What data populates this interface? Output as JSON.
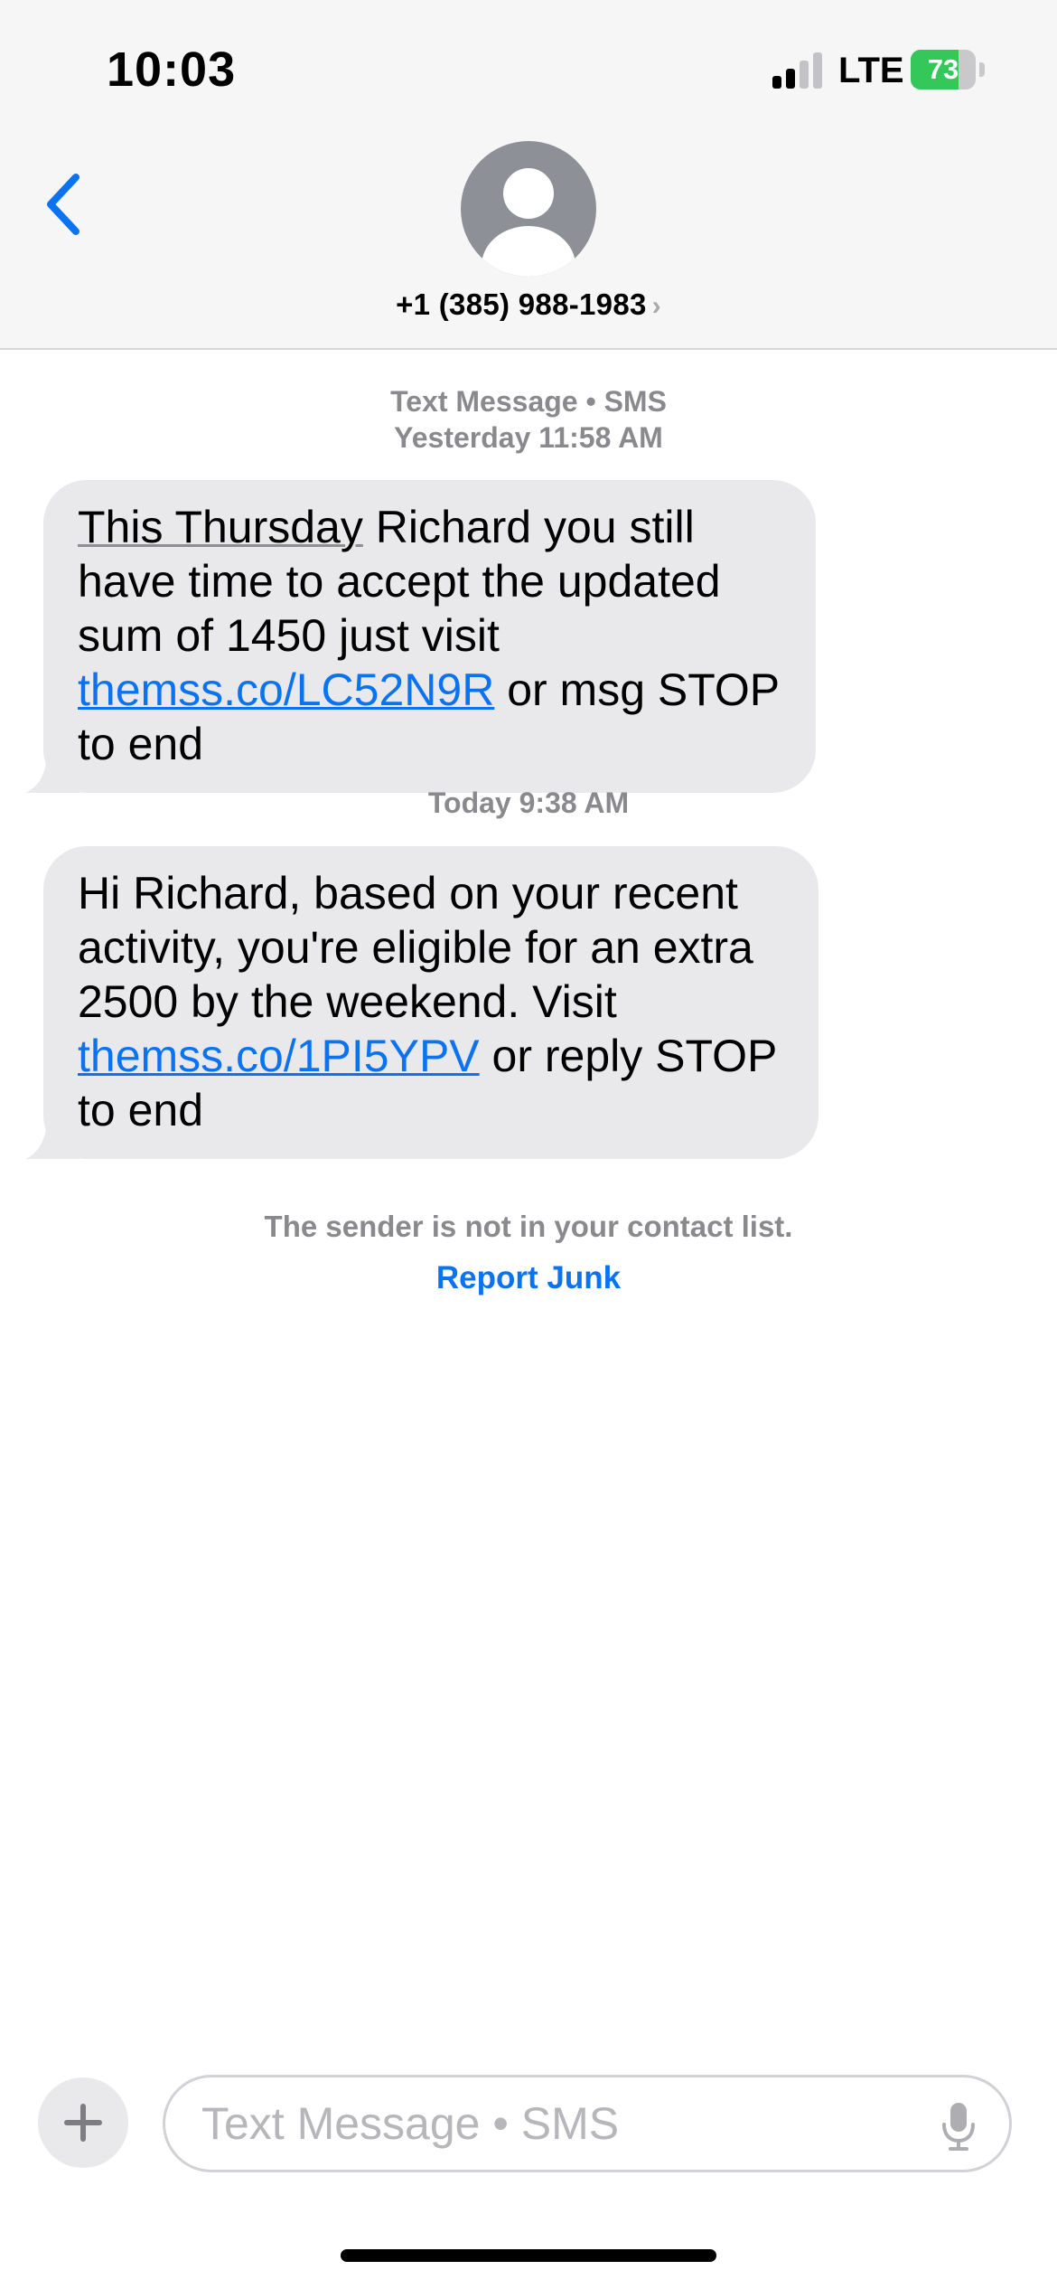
{
  "status_bar": {
    "time": "10:03",
    "network": "LTE",
    "battery_percent": "73",
    "battery_level": 0.73,
    "signal_bars_active": 2,
    "signal_bars_total": 4
  },
  "header": {
    "contact": "+1 (385) 988-1983",
    "back_icon": "chevron-left-icon",
    "avatar_icon": "person-placeholder-icon",
    "chevron": "›"
  },
  "conversation": {
    "first_meta_line1": "Text Message • SMS",
    "first_meta_line2": "Yesterday 11:58 AM",
    "message1": {
      "detected": "This Thursday",
      "text_a": " Richard you still have time to accept the updated sum of 1450 just visit ",
      "link": "themss.co/LC52N9R",
      "text_b": " or msg STOP to end"
    },
    "second_meta": "Today 9:38 AM",
    "message2": {
      "text_a": "Hi Richard, based on your recent activity, you're eligible for an extra 2500 by the weekend. Visit ",
      "link": "themss.co/1PI5YPV",
      "text_b": " or reply STOP to end"
    },
    "notice": "The sender is not in your contact list.",
    "report_junk": "Report Junk"
  },
  "composer": {
    "placeholder": "Text Message • SMS",
    "add_icon": "plus-icon",
    "mic_icon": "microphone-icon"
  },
  "colors": {
    "accent": "#0b73f0",
    "bubble": "#e9e9eb",
    "battery": "#34c759"
  }
}
